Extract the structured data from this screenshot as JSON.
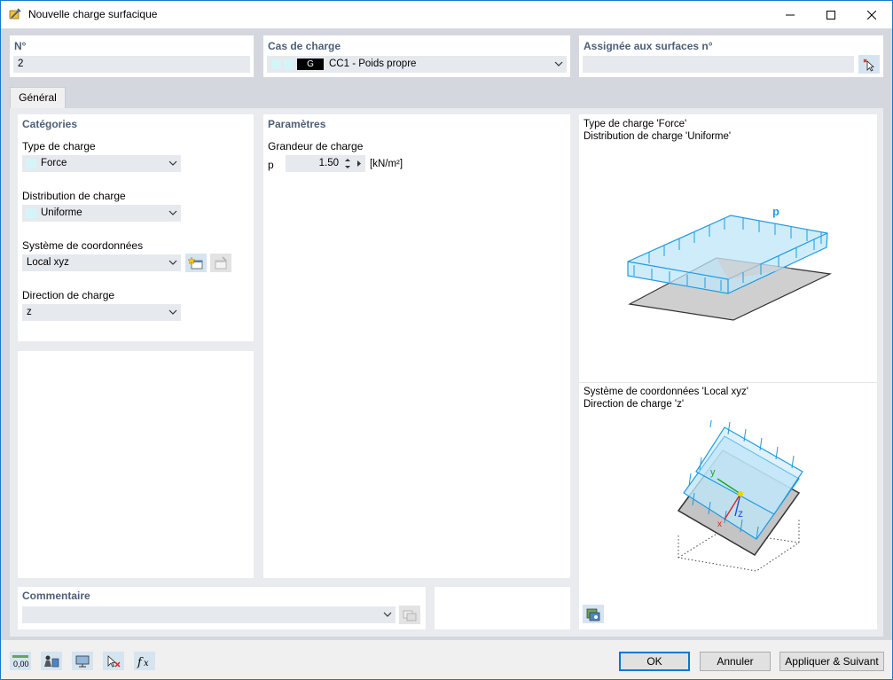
{
  "window": {
    "title": "Nouvelle charge surfacique"
  },
  "top": {
    "number_label": "N°",
    "number_value": "2",
    "loadcase_label": "Cas de charge",
    "loadcase_tag": "G",
    "loadcase_value": "CC1 - Poids propre",
    "assigned_label": "Assignée aux surfaces n°",
    "assigned_value": ""
  },
  "tabs": {
    "general": "Général"
  },
  "categories": {
    "header": "Catégories",
    "load_type_label": "Type de charge",
    "load_type_value": "Force",
    "distribution_label": "Distribution de charge",
    "distribution_value": "Uniforme",
    "coord_label": "Système de coordonnées",
    "coord_value": "Local xyz",
    "direction_label": "Direction de charge",
    "direction_value": "z"
  },
  "parameters": {
    "header": "Paramètres",
    "magnitude_label": "Grandeur de charge",
    "symbol": "p",
    "value": "1.50",
    "unit": "[kN/m²]"
  },
  "preview": {
    "line1": "Type de charge 'Force'",
    "line2": "Distribution de charge 'Uniforme'",
    "line3": "Système de coordonnées 'Local xyz'",
    "line4": "Direction de charge 'z'",
    "diagram_p": "p",
    "axis_y": "y",
    "axis_z": "z",
    "axis_x": "x"
  },
  "comment": {
    "label": "Commentaire",
    "value": ""
  },
  "footer": {
    "ok": "OK",
    "cancel": "Annuler",
    "apply_next": "Appliquer & Suivant",
    "units_icon_text": "0,00"
  },
  "colors": {
    "title_accent": "#1979ca",
    "label_color": "#4d5f78",
    "field_bg": "#e6e9ee",
    "load_blue": "#1e9be0",
    "load_fill": "#bfe6f8"
  }
}
